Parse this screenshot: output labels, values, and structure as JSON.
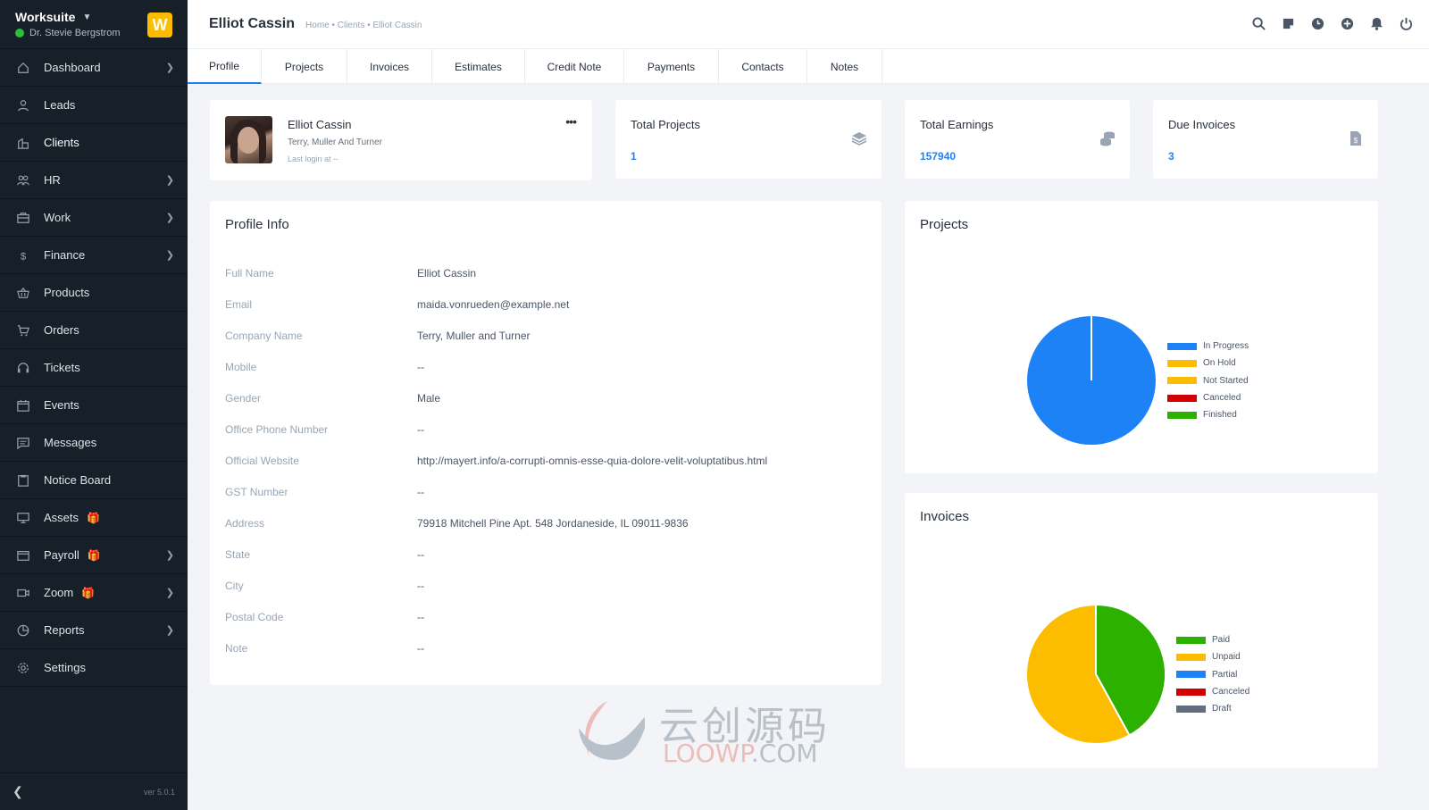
{
  "sidebar": {
    "brand": "Worksuite",
    "user": "Dr. Stevie Bergstrom",
    "logo_letter": "W",
    "items": [
      {
        "label": "Dashboard",
        "icon": "home-icon",
        "chevron": true
      },
      {
        "label": "Leads",
        "icon": "user-icon",
        "chevron": false
      },
      {
        "label": "Clients",
        "icon": "building-icon",
        "chevron": false
      },
      {
        "label": "HR",
        "icon": "people-icon",
        "chevron": true
      },
      {
        "label": "Work",
        "icon": "briefcase-icon",
        "chevron": true
      },
      {
        "label": "Finance",
        "icon": "dollar-icon",
        "chevron": true
      },
      {
        "label": "Products",
        "icon": "basket-icon",
        "chevron": false
      },
      {
        "label": "Orders",
        "icon": "cart-icon",
        "chevron": false
      },
      {
        "label": "Tickets",
        "icon": "headset-icon",
        "chevron": false
      },
      {
        "label": "Events",
        "icon": "calendar-icon",
        "chevron": false
      },
      {
        "label": "Messages",
        "icon": "chat-icon",
        "chevron": false
      },
      {
        "label": "Notice Board",
        "icon": "clipboard-icon",
        "chevron": false
      },
      {
        "label": "Assets",
        "icon": "monitor-icon",
        "chevron": false,
        "gift": true
      },
      {
        "label": "Payroll",
        "icon": "wallet-icon",
        "chevron": true,
        "gift": true
      },
      {
        "label": "Zoom",
        "icon": "video-icon",
        "chevron": true,
        "gift": true
      },
      {
        "label": "Reports",
        "icon": "pie-icon",
        "chevron": true
      },
      {
        "label": "Settings",
        "icon": "gear-icon",
        "chevron": false
      }
    ],
    "version": "ver 5.0.1"
  },
  "header": {
    "title": "Elliot Cassin",
    "breadcrumb": "Home • Clients • Elliot Cassin"
  },
  "tabs": [
    "Profile",
    "Projects",
    "Invoices",
    "Estimates",
    "Credit Note",
    "Payments",
    "Contacts",
    "Notes"
  ],
  "profile_card": {
    "name": "Elliot Cassin",
    "company": "Terry, Muller And Turner",
    "last_login": "Last login at --",
    "more": "•••"
  },
  "stats": [
    {
      "title": "Total Projects",
      "value": "1",
      "icon": "layers-icon"
    },
    {
      "title": "Total Earnings",
      "value": "157940",
      "icon": "coins-icon"
    },
    {
      "title": "Due Invoices",
      "value": "3",
      "icon": "invoice-icon"
    }
  ],
  "profile_info": {
    "title": "Profile Info",
    "rows": [
      {
        "label": "Full Name",
        "value": "Elliot Cassin"
      },
      {
        "label": "Email",
        "value": "maida.vonrueden@example.net"
      },
      {
        "label": "Company Name",
        "value": "Terry, Muller and Turner"
      },
      {
        "label": "Mobile",
        "value": "--"
      },
      {
        "label": "Gender",
        "value": "Male"
      },
      {
        "label": "Office Phone Number",
        "value": "--"
      },
      {
        "label": "Official Website",
        "value": "http://mayert.info/a-corrupti-omnis-esse-quia-dolore-velit-voluptatibus.html"
      },
      {
        "label": "GST Number",
        "value": "--"
      },
      {
        "label": "Address",
        "value": "79918 Mitchell Pine Apt. 548 Jordaneside, IL 09011-9836"
      },
      {
        "label": "State",
        "value": "--"
      },
      {
        "label": "City",
        "value": "--"
      },
      {
        "label": "Postal Code",
        "value": "--"
      },
      {
        "label": "Note",
        "value": "--"
      }
    ]
  },
  "chart_data": [
    {
      "type": "pie",
      "title": "Projects",
      "categories": [
        "In Progress",
        "On Hold",
        "Not Started",
        "Canceled",
        "Finished"
      ],
      "values": [
        1,
        0,
        0,
        0,
        0
      ],
      "colors": [
        "#1d82f5",
        "#fcbd01",
        "#fcbd01",
        "#d30000",
        "#2cb100"
      ],
      "legend": "right"
    },
    {
      "type": "pie",
      "title": "Invoices",
      "categories": [
        "Paid",
        "Unpaid",
        "Partial",
        "Canceled",
        "Draft"
      ],
      "values": [
        42,
        58,
        0,
        0,
        0
      ],
      "colors": [
        "#2cb100",
        "#fcbd01",
        "#1d82f5",
        "#d30000",
        "#616e80"
      ],
      "legend": "right"
    }
  ],
  "watermark": {
    "cn": "云创源码",
    "en_a": "LOOWP",
    "en_b": ".COM"
  },
  "colors": {
    "sidebar_bg": "#171f29",
    "accent": "#1d82f5",
    "brand_yellow": "#fcbd01",
    "online": "#2dbe3a"
  },
  "header_icons": [
    "search-icon",
    "sticky-note-icon",
    "clock-icon",
    "plus-circle-icon",
    "bell-icon",
    "power-icon"
  ]
}
